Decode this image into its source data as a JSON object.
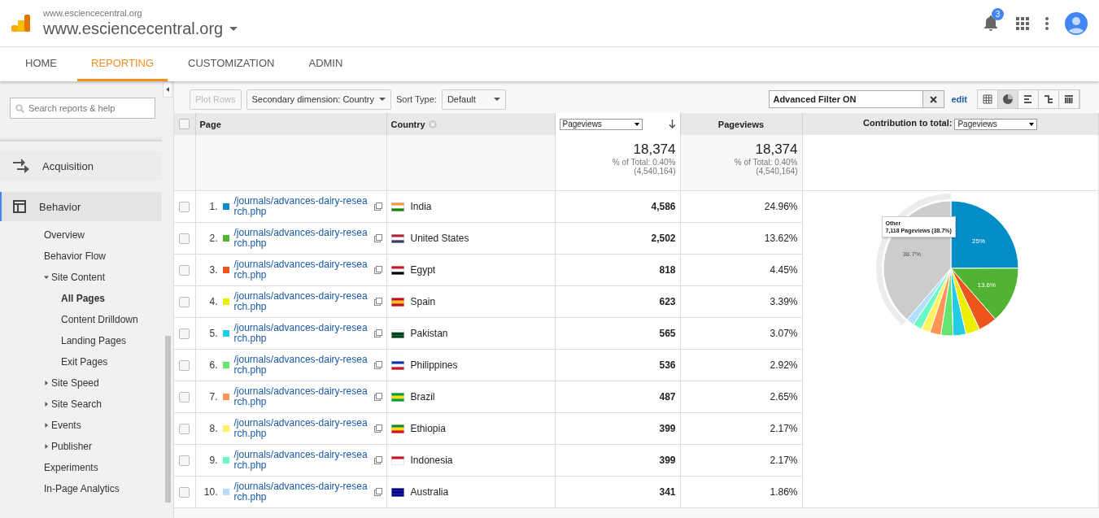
{
  "header": {
    "account": "www.esciencecentral.org",
    "property": "www.esciencecentral.org",
    "notifications": "3"
  },
  "tabs": [
    {
      "label": "HOME",
      "selected": false
    },
    {
      "label": "REPORTING",
      "selected": true
    },
    {
      "label": "CUSTOMIZATION",
      "selected": false
    },
    {
      "label": "ADMIN",
      "selected": false
    }
  ],
  "sidebar": {
    "search_placeholder": "Search reports & help",
    "sections": [
      {
        "label": "Acquisition",
        "selected": false
      },
      {
        "label": "Behavior",
        "selected": true,
        "children": [
          {
            "label": "Overview",
            "selected": false
          },
          {
            "label": "Behavior Flow",
            "selected": false
          },
          {
            "label": "Site Content",
            "selected": false,
            "expanded": true,
            "children": [
              {
                "label": "All Pages",
                "selected": true
              },
              {
                "label": "Content Drilldown",
                "selected": false
              },
              {
                "label": "Landing Pages",
                "selected": false
              },
              {
                "label": "Exit Pages",
                "selected": false
              }
            ]
          },
          {
            "label": "Site Speed",
            "selected": false,
            "expanded": false
          },
          {
            "label": "Site Search",
            "selected": false,
            "expanded": false
          },
          {
            "label": "Events",
            "selected": false,
            "expanded": false
          },
          {
            "label": "Publisher",
            "selected": false,
            "expanded": false
          },
          {
            "label": "Experiments",
            "selected": false
          },
          {
            "label": "In-Page Analytics",
            "selected": false
          }
        ]
      }
    ]
  },
  "toolbar": {
    "plot_rows": {
      "label": "Plot Rows",
      "disabled": true
    },
    "secondary_dimension": "Secondary dimension: Country",
    "sort_label": "Sort Type:",
    "sort_value": "Default",
    "filter": "Advanced Filter ON",
    "edit": "edit",
    "views": [
      {
        "selected": false
      },
      {
        "selected": true
      },
      {
        "selected": false
      },
      {
        "selected": false
      },
      {
        "selected": false
      }
    ]
  },
  "table": {
    "columns": {
      "page": "Page",
      "country": "Country",
      "metric_select": "Pageviews",
      "metric": "Pageviews",
      "contribution_label": "Contribution to total:",
      "contribution_select": "Pageviews",
      "select_all_checked": false
    },
    "totals": [
      {
        "value": "18,374",
        "percent": "% of Total: 0.40%",
        "total": "(4,540,164)"
      },
      {
        "value": "18,374",
        "percent": "% of Total: 0.40%",
        "total": "(4,540,164)"
      }
    ],
    "rows": [
      {
        "index": "1.",
        "page": "/journals/advances-dairy-research.php",
        "color": "#058dc7",
        "country": "India",
        "pageviews": "4,586",
        "share": "24.96%",
        "checked": false
      },
      {
        "index": "2.",
        "page": "/journals/advances-dairy-research.php",
        "color": "#50b432",
        "country": "United States",
        "pageviews": "2,502",
        "share": "13.62%",
        "checked": false
      },
      {
        "index": "3.",
        "page": "/journals/advances-dairy-research.php",
        "color": "#ed561b",
        "country": "Egypt",
        "pageviews": "818",
        "share": "4.45%",
        "checked": false
      },
      {
        "index": "4.",
        "page": "/journals/advances-dairy-research.php",
        "color": "#edef00",
        "country": "Spain",
        "pageviews": "623",
        "share": "3.39%",
        "checked": false
      },
      {
        "index": "5.",
        "page": "/journals/advances-dairy-research.php",
        "color": "#24cbe5",
        "country": "Pakistan",
        "pageviews": "565",
        "share": "3.07%",
        "checked": false
      },
      {
        "index": "6.",
        "page": "/journals/advances-dairy-research.php",
        "color": "#64e572",
        "country": "Philippines",
        "pageviews": "536",
        "share": "2.92%",
        "checked": false
      },
      {
        "index": "7.",
        "page": "/journals/advances-dairy-research.php",
        "color": "#ff9655",
        "country": "Brazil",
        "pageviews": "487",
        "share": "2.65%",
        "checked": false
      },
      {
        "index": "8.",
        "page": "/journals/advances-dairy-research.php",
        "color": "#fff263",
        "country": "Ethiopia",
        "pageviews": "399",
        "share": "2.17%",
        "checked": false
      },
      {
        "index": "9.",
        "page": "/journals/advances-dairy-research.php",
        "color": "#6af9c4",
        "country": "Indonesia",
        "pageviews": "399",
        "share": "2.17%",
        "checked": false
      },
      {
        "index": "10.",
        "page": "/journals/advances-dairy-research.php",
        "color": "#b2deff",
        "country": "Australia",
        "pageviews": "341",
        "share": "1.86%",
        "checked": false
      }
    ],
    "chart_data": {
      "type": "pie",
      "series": [
        {
          "values": [
            24.96,
            13.62,
            4.45,
            3.39,
            3.07,
            2.92,
            2.65,
            2.17,
            2.17,
            1.86,
            38.74
          ]
        }
      ],
      "colors": [
        "#058dc7",
        "#50b432",
        "#ed561b",
        "#edef00",
        "#24cbe5",
        "#64e572",
        "#ff9655",
        "#fff263",
        "#6af9c4",
        "#b2deff",
        "#cccccc"
      ],
      "value_labels": [
        "25%",
        "13.6%",
        null,
        null,
        null,
        null,
        null,
        null,
        null,
        null,
        "38.7%"
      ]
    },
    "tooltip": {
      "title": "Other",
      "text": "7,118 Pageviews (38.7%)"
    }
  }
}
